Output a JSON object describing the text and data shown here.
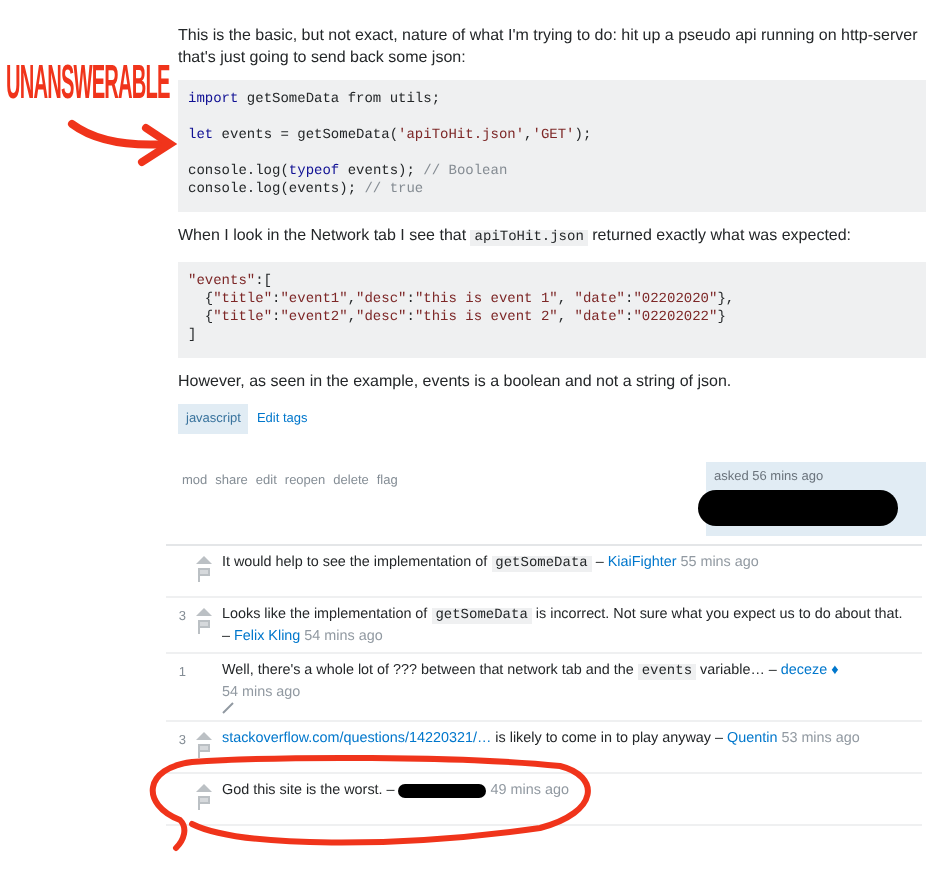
{
  "annotation": {
    "label": "UNANSWERABLE"
  },
  "question": {
    "paragraph_1": [
      {
        "kind": "text",
        "text": "This is the basic, but not exact, nature of what I'm trying to do: hit up a pseudo api running on http-server that's just going to send back some json:"
      }
    ],
    "code_1": [
      {
        "tokens": [
          {
            "kind": "kw",
            "text": "import"
          },
          {
            "kind": "plain",
            "text": " getSomeData from utils;"
          }
        ]
      },
      {
        "blank": true
      },
      {
        "tokens": [
          {
            "kind": "kw",
            "text": "let"
          },
          {
            "kind": "plain",
            "text": " events = getSomeData("
          },
          {
            "kind": "str",
            "text": "'apiToHit.json'"
          },
          {
            "kind": "plain",
            "text": ","
          },
          {
            "kind": "str",
            "text": "'GET'"
          },
          {
            "kind": "plain",
            "text": ");"
          }
        ]
      },
      {
        "blank": true
      },
      {
        "tokens": [
          {
            "kind": "plain",
            "text": "console.log("
          },
          {
            "kind": "kw",
            "text": "typeof"
          },
          {
            "kind": "plain",
            "text": " events); "
          },
          {
            "kind": "com",
            "text": "// Boolean"
          }
        ]
      },
      {
        "tokens": [
          {
            "kind": "plain",
            "text": "console.log(events); "
          },
          {
            "kind": "com",
            "text": "// true"
          }
        ]
      }
    ],
    "paragraph_2": [
      {
        "kind": "text",
        "text": "When I look in the Network tab I see that "
      },
      {
        "kind": "code",
        "text": "apiToHit.json"
      },
      {
        "kind": "text",
        "text": " returned exactly what was expected:"
      }
    ],
    "code_2": [
      {
        "tokens": [
          {
            "kind": "str",
            "text": "\"events\""
          },
          {
            "kind": "plain",
            "text": ":["
          }
        ]
      },
      {
        "tokens": [
          {
            "kind": "plain",
            "text": "  {"
          },
          {
            "kind": "str",
            "text": "\"title\""
          },
          {
            "kind": "plain",
            "text": ":"
          },
          {
            "kind": "str",
            "text": "\"event1\""
          },
          {
            "kind": "plain",
            "text": ","
          },
          {
            "kind": "str",
            "text": "\"desc\""
          },
          {
            "kind": "plain",
            "text": ":"
          },
          {
            "kind": "str",
            "text": "\"this is event 1\""
          },
          {
            "kind": "plain",
            "text": ", "
          },
          {
            "kind": "str",
            "text": "\"date\""
          },
          {
            "kind": "plain",
            "text": ":"
          },
          {
            "kind": "str",
            "text": "\"02202020\""
          },
          {
            "kind": "plain",
            "text": "},"
          }
        ]
      },
      {
        "tokens": [
          {
            "kind": "plain",
            "text": "  {"
          },
          {
            "kind": "str",
            "text": "\"title\""
          },
          {
            "kind": "plain",
            "text": ":"
          },
          {
            "kind": "str",
            "text": "\"event2\""
          },
          {
            "kind": "plain",
            "text": ","
          },
          {
            "kind": "str",
            "text": "\"desc\""
          },
          {
            "kind": "plain",
            "text": ":"
          },
          {
            "kind": "str",
            "text": "\"this is event 2\""
          },
          {
            "kind": "plain",
            "text": ", "
          },
          {
            "kind": "str",
            "text": "\"date\""
          },
          {
            "kind": "plain",
            "text": ":"
          },
          {
            "kind": "str",
            "text": "\"02202022\""
          },
          {
            "kind": "plain",
            "text": "}"
          }
        ]
      },
      {
        "tokens": [
          {
            "kind": "plain",
            "text": "]"
          }
        ]
      }
    ],
    "paragraph_3": [
      {
        "kind": "text",
        "text": "However, as seen in the example, events is a boolean and not a string of json."
      }
    ],
    "tags": [
      "javascript"
    ],
    "edit_tags_link": "Edit tags",
    "actions": [
      "mod",
      "share",
      "edit",
      "reopen",
      "delete",
      "flag"
    ],
    "asked": "asked 56 mins ago",
    "author_redacted": true
  },
  "comments": [
    {
      "vote_icons": true,
      "parts": [
        {
          "kind": "text",
          "text": "It would help to see the implementation of "
        },
        {
          "kind": "code",
          "text": "getSomeData"
        },
        {
          "kind": "text",
          "text": " –"
        }
      ],
      "author": "KiaiFighter",
      "author_redacted": false,
      "time": "55 mins ago",
      "edited": false
    },
    {
      "score": "3",
      "vote_icons": true,
      "parts": [
        {
          "kind": "text",
          "text": "Looks like the implementation of "
        },
        {
          "kind": "code",
          "text": "getSomeData"
        },
        {
          "kind": "text",
          "text": " is incorrect. Not sure what you expect us to do about that. –"
        }
      ],
      "author": "Felix Kling",
      "author_redacted": false,
      "time": "54 mins ago",
      "edited": false
    },
    {
      "score": "1",
      "vote_icons": false,
      "parts": [
        {
          "kind": "text",
          "text": "Well, there's a whole lot of ??? between that network tab and the "
        },
        {
          "kind": "code",
          "text": "events"
        },
        {
          "kind": "text",
          "text": " variable… –"
        }
      ],
      "author": "deceze",
      "author_redacted": false,
      "mod_mark": "♦",
      "time": "54 mins ago",
      "edited": true
    },
    {
      "score": "3",
      "vote_icons": true,
      "parts": [
        {
          "kind": "link",
          "text": "stackoverflow.com/questions/14220321/…"
        },
        {
          "kind": "text",
          "text": " is likely to come in to play anyway –"
        }
      ],
      "author": "Quentin",
      "author_redacted": false,
      "time": "53 mins ago",
      "edited": false
    },
    {
      "vote_icons": true,
      "parts": [
        {
          "kind": "text",
          "text": "God this site is the worst. –"
        }
      ],
      "author_redacted": true,
      "time": "49 mins ago",
      "edited": false
    }
  ]
}
